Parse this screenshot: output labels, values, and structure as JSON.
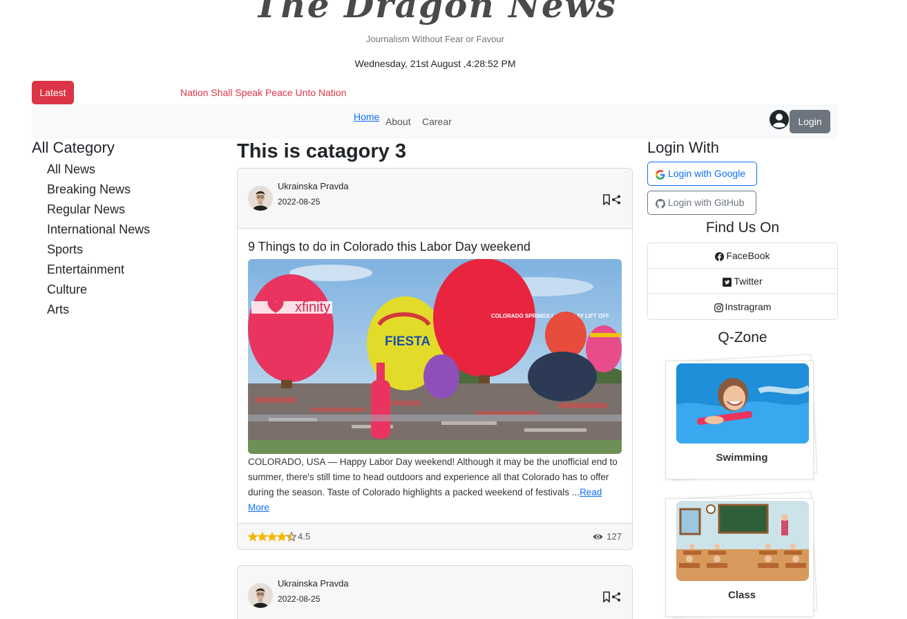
{
  "header": {
    "logo": "The Dragon News",
    "tagline": "Journalism Without Fear or Favour",
    "datetime": "Wednesday, 21st August ,4:28:52 PM"
  },
  "ticker": {
    "badge": "Latest",
    "headline": "Nation Shall Speak Peace Unto Nation"
  },
  "nav": {
    "items": [
      "Home",
      "About",
      "Carear"
    ],
    "login": "Login"
  },
  "left_sidebar": {
    "title": "All Category",
    "categories": [
      "All News",
      "Breaking News",
      "Regular News",
      "International News",
      "Sports",
      "Entertainment",
      "Culture",
      "Arts"
    ]
  },
  "main": {
    "heading": "This is catagory 3",
    "cards": [
      {
        "author": "Ukrainska Pravda",
        "date": "2022-08-25",
        "title": "9 Things to do in Colorado this Labor Day weekend",
        "excerpt": "COLORADO, USA — Happy Labor Day weekend! Although it may be the unofficial end to summer, there's still time to head outdoors and experience all that Colorado has to offer during the season. Taste of Colorado highlights a packed weekend of festivals ...",
        "read_more": "Read More",
        "rating_value": 4.5,
        "rating": "4.5",
        "views": "127",
        "image_text": {
          "balloon1": "xfinity",
          "balloon2": "FIESTA",
          "balloon3": "COLORADO SPRINGS LABOR DAY LIFT OFF"
        }
      },
      {
        "author": "Ukrainska Pravda",
        "date": "2022-08-25"
      }
    ]
  },
  "right_sidebar": {
    "login_title": "Login With",
    "google": "Login with Google",
    "github": "Login with GitHub",
    "find_us": "Find Us On",
    "social": [
      "FaceBook",
      "Twitter",
      "Instragram"
    ],
    "qzone_title": "Q-Zone",
    "qzone": [
      "Swimming",
      "Class"
    ]
  },
  "colors": {
    "danger": "#dc3545",
    "primary": "#0d6efd",
    "secondary": "#6c757d",
    "star": "#f5b800"
  }
}
